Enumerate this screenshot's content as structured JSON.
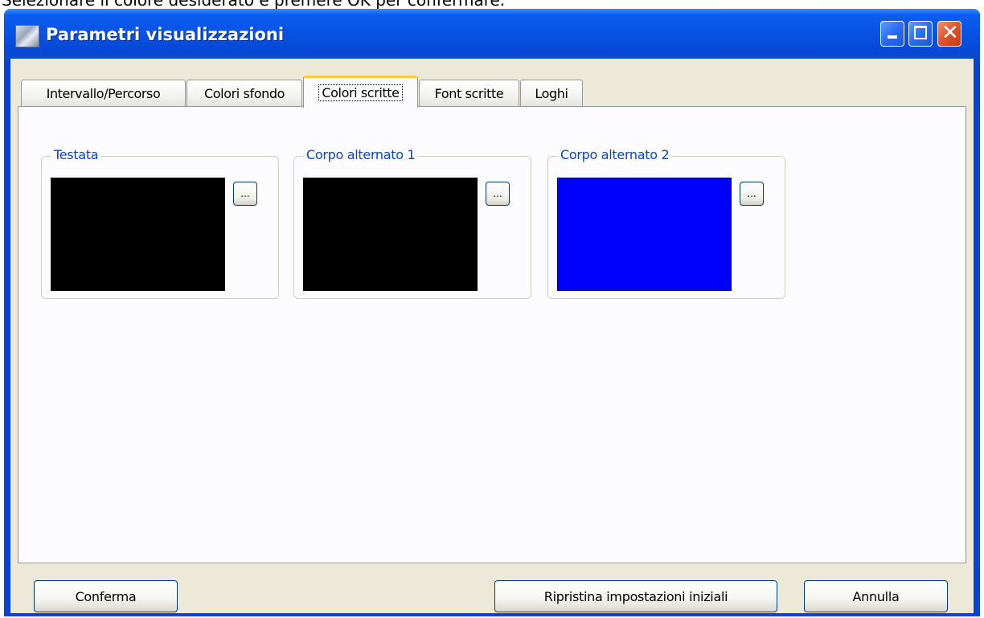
{
  "caption": "Selezionare il colore desiderato e premere OK per confermare.",
  "window": {
    "title": "Parametri visualizzazioni",
    "controls": [
      "minimize-icon",
      "maximize-icon",
      "close-icon"
    ]
  },
  "tabs": [
    {
      "label": "Intervallo/Percorso"
    },
    {
      "label": "Colori sfondo"
    },
    {
      "label": "Colori scritte",
      "selected": true
    },
    {
      "label": "Font scritte"
    },
    {
      "label": "Loghi"
    }
  ],
  "groups": [
    {
      "label": "Testata",
      "color": "#000000",
      "button_label": "..."
    },
    {
      "label": "Corpo alternato 1",
      "color": "#000000",
      "button_label": "..."
    },
    {
      "label": "Corpo alternato 2",
      "color": "#0000ff",
      "button_label": "..."
    }
  ],
  "buttons": {
    "confirm": "Conferma",
    "reset": "Ripristina impostazioni iniziali",
    "cancel": "Annulla"
  },
  "colors": {
    "titlebar": "#0a5df2",
    "group_label": "#0046d5",
    "active_tab_highlight": "#ffc83c",
    "dialog_bg": "#ece9d8"
  }
}
